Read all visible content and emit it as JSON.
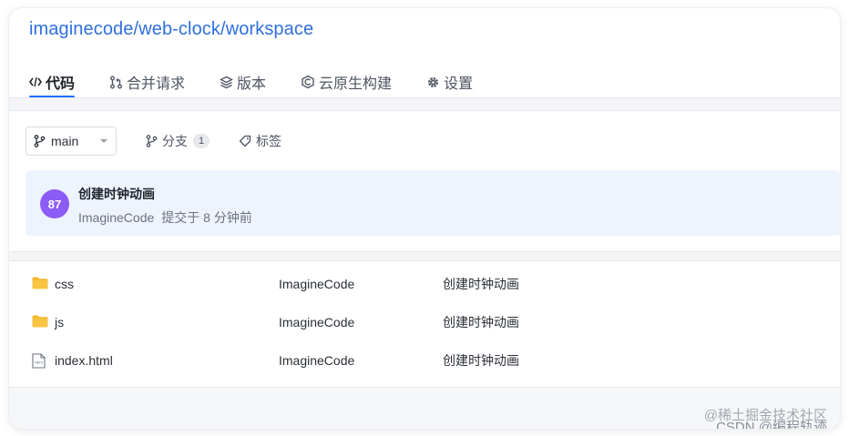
{
  "repo": {
    "owner": "imaginecode",
    "name": "web-clock",
    "branch_path": "workspace",
    "separator": "/"
  },
  "tabs": [
    {
      "label": "代码",
      "icon": "code-icon",
      "active": true
    },
    {
      "label": "合并请求",
      "icon": "merge-request-icon",
      "active": false
    },
    {
      "label": "版本",
      "icon": "layers-icon",
      "active": false
    },
    {
      "label": "云原生构建",
      "icon": "cloud-build-icon",
      "active": false
    },
    {
      "label": "设置",
      "icon": "gear-icon",
      "active": false
    }
  ],
  "toolbar": {
    "branch": "main",
    "branches_label": "分支",
    "branches_count": "1",
    "tags_label": "标签"
  },
  "latest_commit": {
    "avatar_text": "87",
    "avatar_color": "#8d5cf6",
    "message": "创建时钟动画",
    "author": "ImagineCode",
    "time": "提交于 8 分钟前"
  },
  "files": [
    {
      "type": "folder",
      "name": "css",
      "author": "ImagineCode",
      "message": "创建时钟动画"
    },
    {
      "type": "folder",
      "name": "js",
      "author": "ImagineCode",
      "message": "创建时钟动画"
    },
    {
      "type": "html",
      "name": "index.html",
      "author": "ImagineCode",
      "message": "创建时钟动画"
    }
  ],
  "watermark": {
    "line1": "@稀土掘金技术社区",
    "line2": "CSDN @编程轨迹"
  },
  "colors": {
    "link": "#2e6fe0",
    "tab_indicator": "#1e6fff",
    "folder": "#f5b82e",
    "commit_bg": "#eef4fe"
  }
}
